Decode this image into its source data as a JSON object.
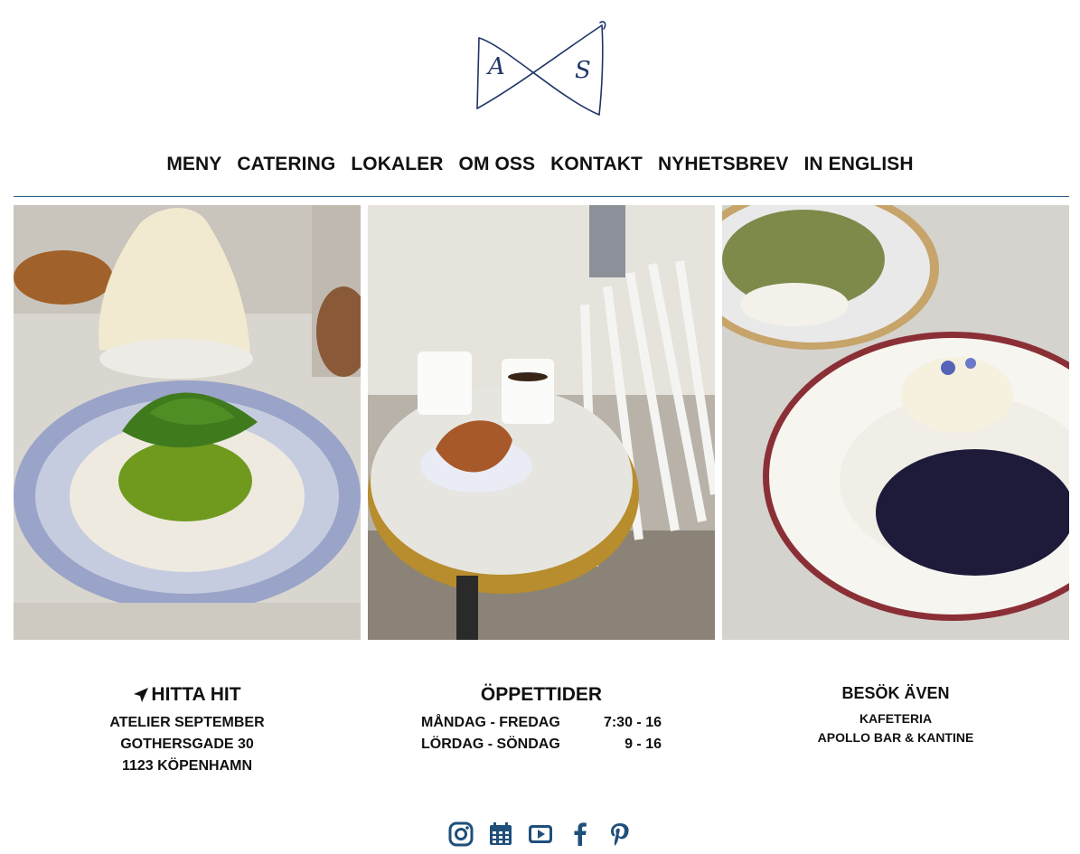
{
  "logo": {
    "letters": [
      "A",
      "S"
    ]
  },
  "nav": [
    "MENY",
    "CATERING",
    "LOKALER",
    "OM OSS",
    "KONTAKT",
    "NYHETSBREV",
    "IN ENGLISH"
  ],
  "find_us": {
    "title": "HITTA HIT",
    "icon": "location-arrow-icon",
    "lines": [
      "ATELIER SEPTEMBER",
      "GOTHERSGADE 30",
      "1123 KÖPENHAMN"
    ]
  },
  "hours": {
    "title": "ÖPPETTIDER",
    "rows": [
      {
        "days": "MÅNDAG - FREDAG",
        "time": "7:30 - 16"
      },
      {
        "days": "LÖRDAG - SÖNDAG",
        "time": "9 - 16"
      }
    ]
  },
  "also_visit": {
    "title": "BESÖK ÄVEN",
    "items": [
      "KAFETERIA",
      "APOLLO BAR & KANTINE"
    ]
  },
  "social_icons": [
    "instagram-icon",
    "calendar-icon",
    "youtube-icon",
    "facebook-icon",
    "pinterest-icon"
  ],
  "colors": {
    "accent": "#1f4f7a",
    "rule": "#2c5f8a",
    "text": "#111111"
  }
}
